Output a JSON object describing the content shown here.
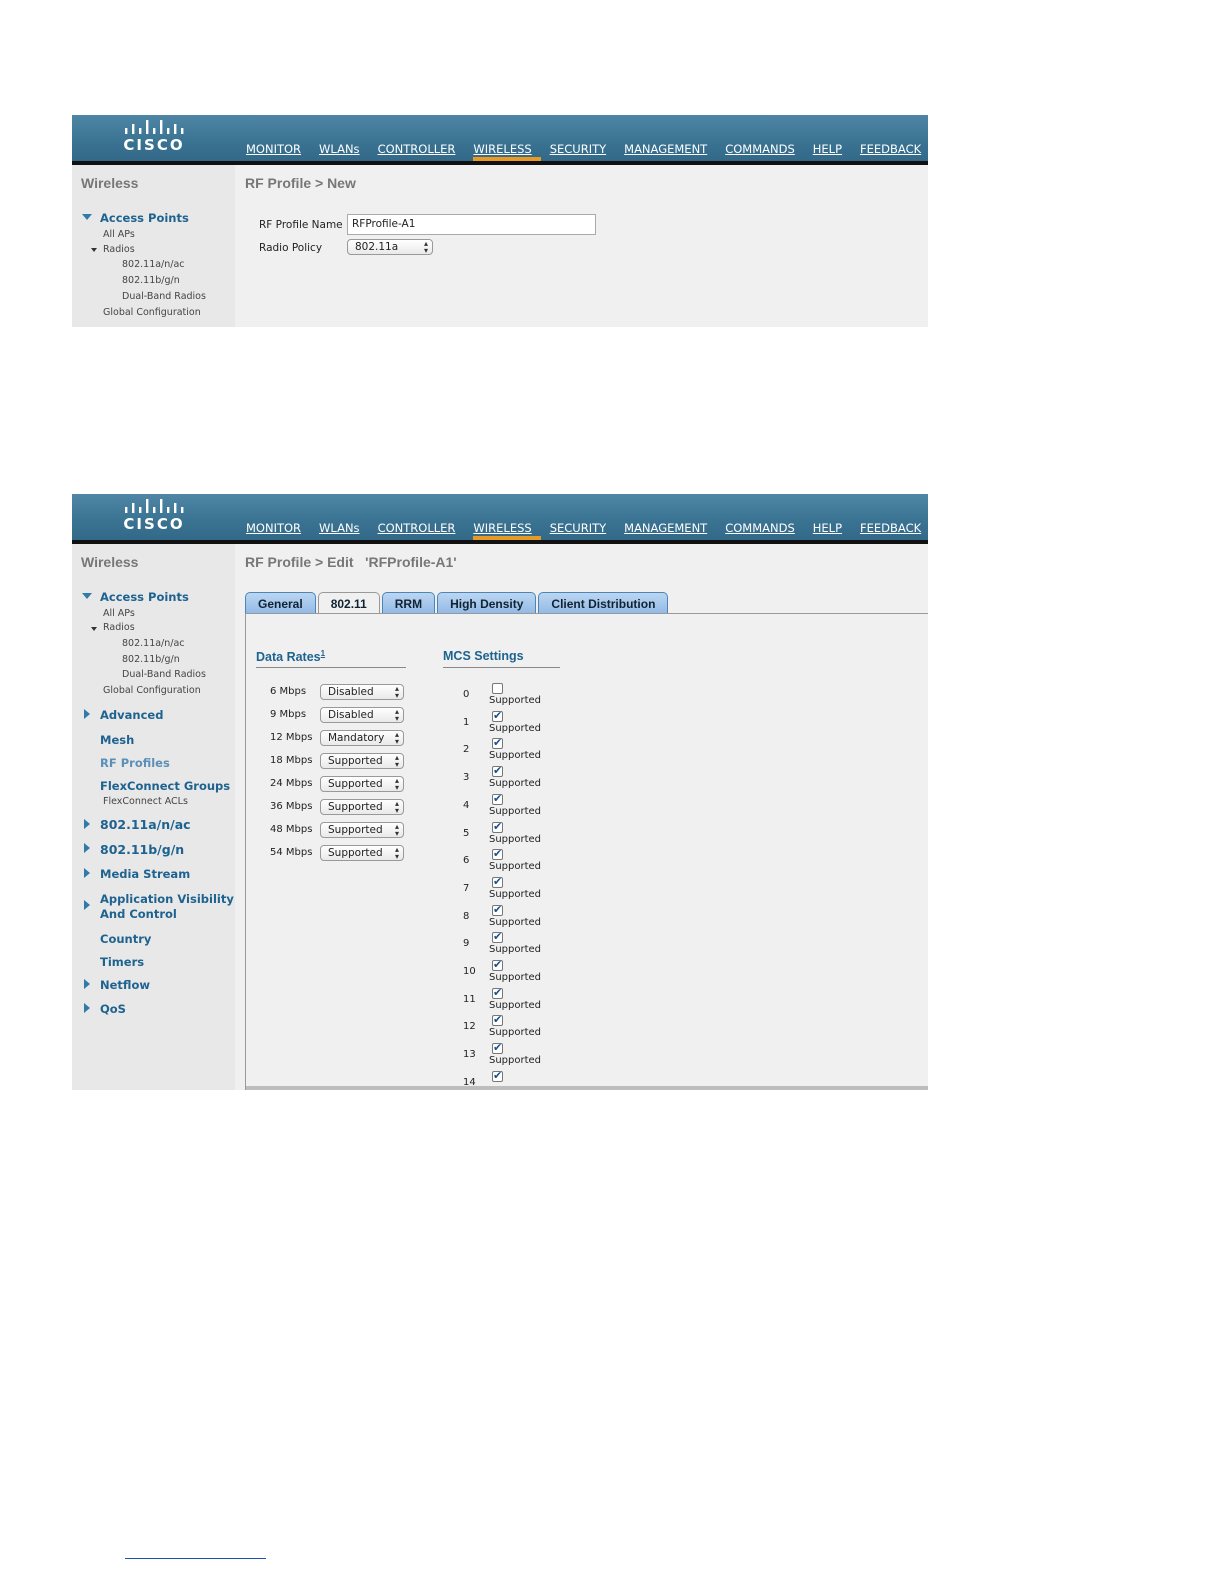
{
  "logo_text": "CISCO",
  "menu": [
    "MONITOR",
    "WLANs",
    "CONTROLLER",
    "WIRELESS",
    "SECURITY",
    "MANAGEMENT",
    "COMMANDS",
    "HELP",
    "FEEDBACK"
  ],
  "menu_active": "WIRELESS",
  "accent_color": "#e89b24",
  "side_title": "Wireless",
  "shot1": {
    "sidebar": {
      "access_points": "Access Points",
      "all_aps": "All APs",
      "radios": "Radios",
      "radio_a": "802.11a/n/ac",
      "radio_b": "802.11b/g/n",
      "dual_band": "Dual-Band Radios",
      "global_config": "Global Configuration"
    },
    "page_title": "RF Profile > New",
    "profile_name_label": "RF Profile Name",
    "profile_name_value": "RFProfile-A1",
    "radio_policy_label": "Radio Policy",
    "radio_policy_value": "802.11a"
  },
  "shot2": {
    "sidebar": {
      "access_points": "Access Points",
      "all_aps": "All APs",
      "radios": "Radios",
      "radio_a": "802.11a/n/ac",
      "radio_b": "802.11b/g/n",
      "dual_band": "Dual-Band Radios",
      "global_config": "Global Configuration",
      "advanced": "Advanced",
      "mesh": "Mesh",
      "rf_profiles": "RF Profiles",
      "flexconnect_groups": "FlexConnect Groups",
      "flexconnect_acls": "FlexConnect ACLs",
      "dot11a": "802.11a/n/ac",
      "dot11b": "802.11b/g/n",
      "media_stream": "Media Stream",
      "avc_line1": "Application Visibility",
      "avc_line2": "And Control",
      "country": "Country",
      "timers": "Timers",
      "netflow": "Netflow",
      "qos": "QoS"
    },
    "page_title": "RF Profile > Edit   'RFProfile-A1'",
    "tabs": [
      "General",
      "802.11",
      "RRM",
      "High Density",
      "Client Distribution"
    ],
    "active_tab": "802.11",
    "data_rates_title": "Data Rates",
    "data_rates_footnote": "1",
    "mcs_title": "MCS Settings",
    "data_rates": [
      {
        "rate": "6 Mbps",
        "value": "Disabled"
      },
      {
        "rate": "9 Mbps",
        "value": "Disabled"
      },
      {
        "rate": "12 Mbps",
        "value": "Mandatory"
      },
      {
        "rate": "18 Mbps",
        "value": "Supported"
      },
      {
        "rate": "24 Mbps",
        "value": "Supported"
      },
      {
        "rate": "36 Mbps",
        "value": "Supported"
      },
      {
        "rate": "48 Mbps",
        "value": "Supported"
      },
      {
        "rate": "54 Mbps",
        "value": "Supported"
      }
    ],
    "mcs_label": "Supported",
    "mcs": [
      {
        "index": "0",
        "checked": false
      },
      {
        "index": "1",
        "checked": true
      },
      {
        "index": "2",
        "checked": true
      },
      {
        "index": "3",
        "checked": true
      },
      {
        "index": "4",
        "checked": true
      },
      {
        "index": "5",
        "checked": true
      },
      {
        "index": "6",
        "checked": true
      },
      {
        "index": "7",
        "checked": true
      },
      {
        "index": "8",
        "checked": true
      },
      {
        "index": "9",
        "checked": true
      },
      {
        "index": "10",
        "checked": true
      },
      {
        "index": "11",
        "checked": true
      },
      {
        "index": "12",
        "checked": true
      },
      {
        "index": "13",
        "checked": true
      },
      {
        "index": "14",
        "checked": true
      }
    ]
  }
}
